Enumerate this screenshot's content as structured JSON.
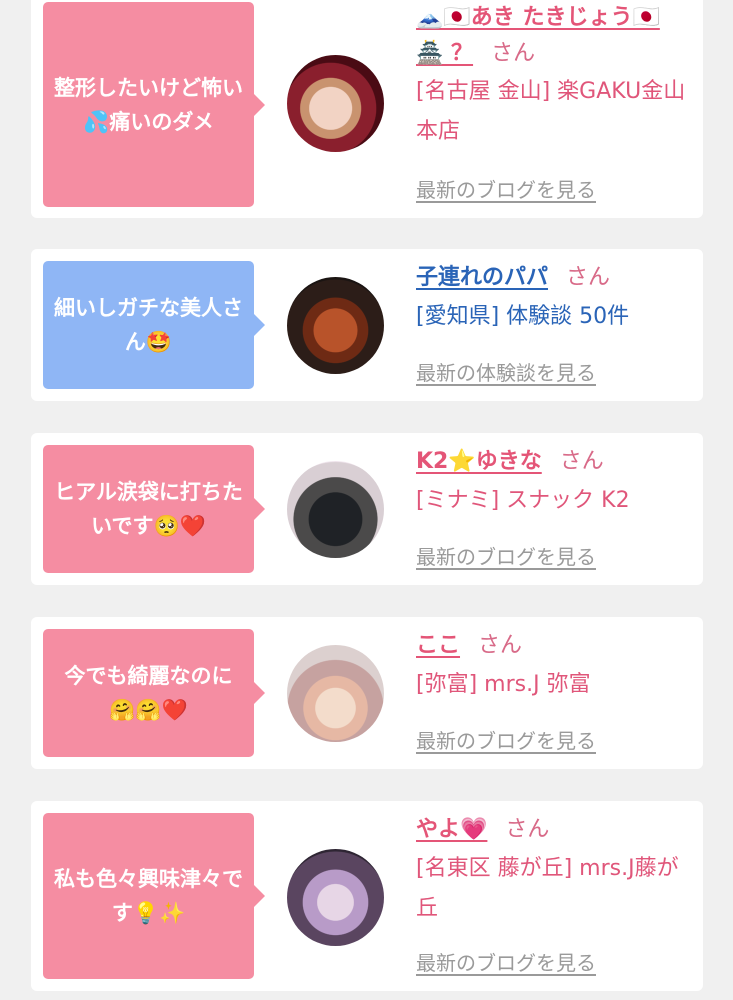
{
  "cards": [
    {
      "comment": "整形したいけど怖い💦痛いのダメ",
      "name": "🗻🇯🇵あき たきじょう🇯🇵🏯 ？",
      "honorific": "さん",
      "location": "[名古屋 金山] 楽GAKU金山本店",
      "link": "最新のブログを見る",
      "bubble_color": "#f58da2"
    },
    {
      "comment": "細いしガチな美人さん🤩",
      "name": "子連れのパパ",
      "honorific": "さん",
      "location": "[愛知県] 体験談 50件",
      "link": "最新の体験談を見る",
      "bubble_color": "#8fb6f5"
    },
    {
      "comment": "ヒアル涙袋に打ちたいです🥺❤️",
      "name": "K2⭐ゆきな",
      "honorific": "さん",
      "location": "[ミナミ] スナック K2",
      "link": "最新のブログを見る",
      "bubble_color": "#f58da2"
    },
    {
      "comment": "今でも綺麗なのに🤗🤗❤️",
      "name": "ここ",
      "honorific": "さん",
      "location": "[弥富] mrs.J 弥富",
      "link": "最新のブログを見る",
      "bubble_color": "#f58da2"
    },
    {
      "comment": "私も色々興味津々です💡✨",
      "name": "やよ💗",
      "honorific": "さん",
      "location": "[名東区 藤が丘] mrs.J藤が丘",
      "link": "最新のブログを見る",
      "bubble_color": "#f58da2"
    }
  ]
}
